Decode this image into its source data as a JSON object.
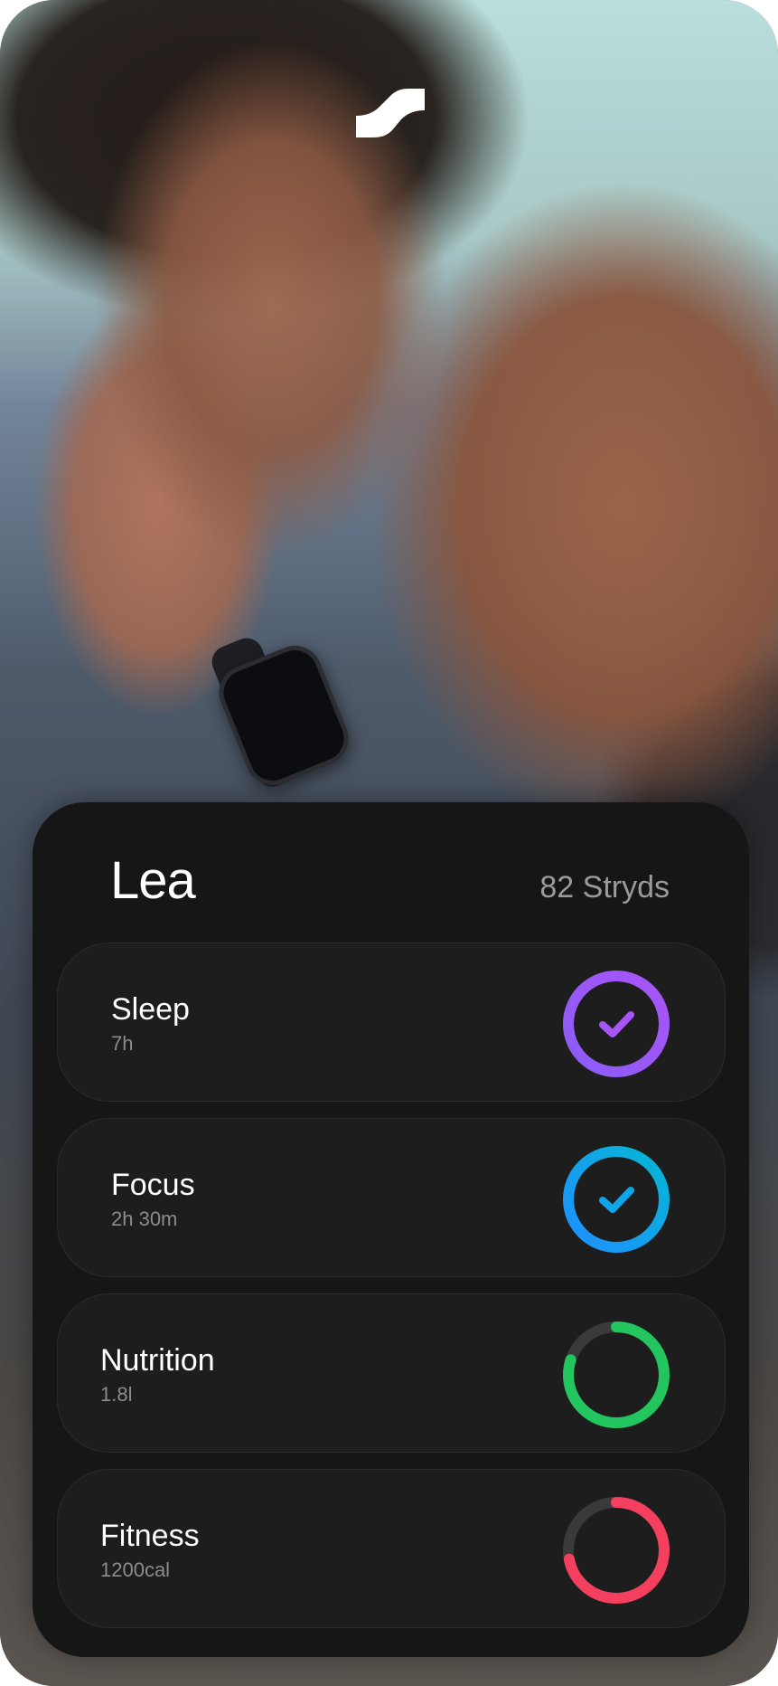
{
  "profile": {
    "name": "Lea",
    "stryds": "82 Stryds"
  },
  "metrics": [
    {
      "label": "Sleep",
      "value": "7h",
      "color": "#8b5cf6",
      "color2": "#a855f7",
      "progress": 1.0,
      "status": "complete",
      "icon": "check-icon"
    },
    {
      "label": "Focus",
      "value": "2h 30m",
      "color": "#0ea5e9",
      "color2": "#1e90ff",
      "progress": 1.0,
      "status": "complete",
      "icon": "check-icon"
    },
    {
      "label": "Nutrition",
      "value": "1.8l",
      "color": "#22c55e",
      "color2": "#22c55e",
      "progress": 0.8,
      "status": "in-progress"
    },
    {
      "label": "Fitness",
      "value": "1200cal",
      "color": "#f43f5e",
      "color2": "#ff3b4e",
      "progress": 0.72,
      "status": "in-progress"
    }
  ],
  "icons": {
    "logo": "stryd-logo-icon"
  },
  "colors": {
    "card_background": "#161616",
    "tile_background": "#1d1d1d",
    "ring_track": "#3a3a3a"
  }
}
